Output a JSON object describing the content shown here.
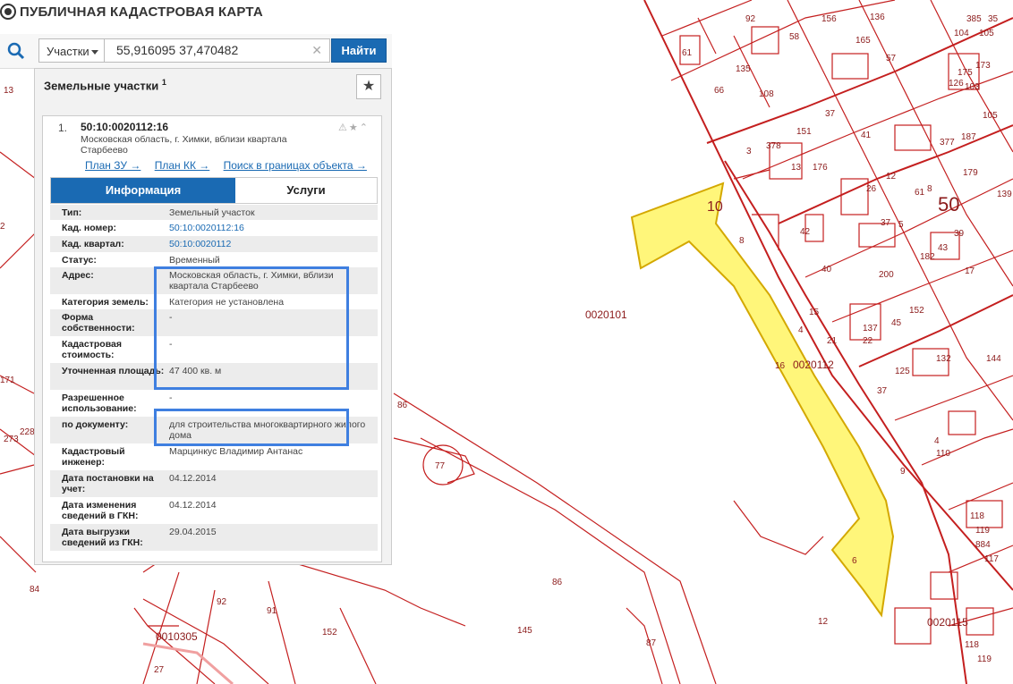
{
  "app": {
    "title": "ПУБЛИЧНАЯ КАДАСТРОВАЯ КАРТА"
  },
  "search": {
    "type_label": "Участки",
    "query": "55,916095 37,470482",
    "button": "Найти"
  },
  "results": {
    "title": "Земельные участки",
    "count_sup": "1",
    "item": {
      "index": "1.",
      "cad_number": "50:10:0020112:16",
      "address": "Московская область, г. Химки, вблизи квартала Старбеево",
      "links": [
        "План ЗУ →",
        "План КК →",
        "Поиск в границах объекта →"
      ],
      "tabs": [
        "Информация",
        "Услуги"
      ],
      "fields": [
        {
          "k": "Тип:",
          "v": "Земельный участок"
        },
        {
          "k": "Кад. номер:",
          "v": "50:10:0020112:16"
        },
        {
          "k": "Кад. квартал:",
          "v": "50:10:0020112"
        },
        {
          "k": "Статус:",
          "v": "Временный"
        },
        {
          "k": "Адрес:",
          "v": "Московская область, г. Химки, вблизи квартала Старбеево"
        },
        {
          "k": "Категория земель:",
          "v": "Категория не установлена"
        },
        {
          "k": "Форма собственности:",
          "v": "-"
        },
        {
          "k": "Кадастровая стоимость:",
          "v": "-"
        },
        {
          "k": "Уточненная площадь:",
          "v": "47 400 кв. м"
        },
        {
          "k": "Разрешенное использование:",
          "v": "-"
        },
        {
          "k": "по документу:",
          "v": "для строительства многоквартирного жилого дома"
        },
        {
          "k": "Кадастровый инженер:",
          "v": "Марцинкус Владимир Антанас"
        },
        {
          "k": "Дата постановки на учет:",
          "v": "04.12.2014"
        },
        {
          "k": "Дата изменения сведений в ГКН:",
          "v": "04.12.2014"
        },
        {
          "k": "Дата выгрузки сведений из ГКН:",
          "v": "29.04.2015"
        }
      ]
    }
  },
  "map": {
    "colors": {
      "parcel_line": "#c41f1f",
      "selected_fill": "#fff67a",
      "selected_stroke": "#d4a800"
    },
    "labels": [
      "10",
      "50",
      "8",
      "0020101",
      "0020112",
      "16",
      "4",
      "21",
      "15",
      "86",
      "77",
      "9",
      "6",
      "12",
      "86",
      "145",
      "87",
      "84",
      "91",
      "152",
      "92",
      "0010305",
      "27",
      "0020115",
      "171",
      "273",
      "228",
      "2",
      "13",
      "58",
      "165",
      "156",
      "136",
      "92",
      "135",
      "108",
      "66",
      "37",
      "151",
      "176",
      "13",
      "41",
      "3",
      "378",
      "377",
      "187",
      "179",
      "105",
      "139",
      "26",
      "12",
      "61",
      "37",
      "39",
      "43",
      "42",
      "182",
      "17",
      "40",
      "200",
      "152",
      "45",
      "137",
      "22",
      "132",
      "144",
      "125",
      "4",
      "110",
      "118",
      "119",
      "884",
      "117",
      "118",
      "119",
      "61",
      "57",
      "35",
      "385",
      "173",
      "175",
      "126",
      "103",
      "105",
      "104",
      "8",
      "5",
      "37",
      "39",
      "24"
    ]
  }
}
